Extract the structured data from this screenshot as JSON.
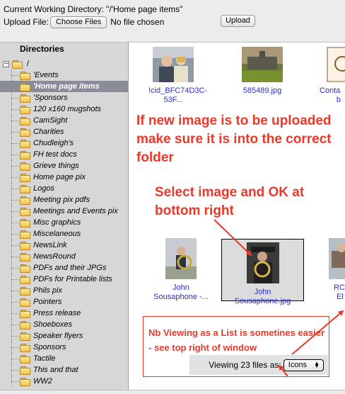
{
  "header": {
    "cwd_text": "Current Working Directory: \"/'Home page items\"",
    "upload_label": "Upload File:",
    "choose_files_label": "Choose Files",
    "no_file_label": "No file chosen",
    "upload_button_label": "Upload"
  },
  "sidebar": {
    "title": "Directories",
    "root_toggle": "−",
    "root_label": "/",
    "items": [
      {
        "label": "'Events"
      },
      {
        "label": "'Home page items",
        "selected": true
      },
      {
        "label": "'Sponsors"
      },
      {
        "label": "120 x160 mugshots"
      },
      {
        "label": "CamSight"
      },
      {
        "label": "Charities"
      },
      {
        "label": "Chudleigh's"
      },
      {
        "label": "FH test docs"
      },
      {
        "label": "Grieve things"
      },
      {
        "label": "Home page pix"
      },
      {
        "label": "Logos"
      },
      {
        "label": "Meeting pix pdfs"
      },
      {
        "label": "Meetings and Events pix"
      },
      {
        "label": "Misc graphics"
      },
      {
        "label": "Miscelaneous"
      },
      {
        "label": "NewsLink"
      },
      {
        "label": "NewsRound"
      },
      {
        "label": "PDFs and their JPGs"
      },
      {
        "label": "PDFs for Printable lists"
      },
      {
        "label": "Phils pix"
      },
      {
        "label": "Pointers"
      },
      {
        "label": "Press release"
      },
      {
        "label": "Shoeboxes"
      },
      {
        "label": "Speaker flyers"
      },
      {
        "label": "Sponsors"
      },
      {
        "label": "Tactile"
      },
      {
        "label": "This and that"
      },
      {
        "label": "WW2"
      }
    ]
  },
  "files": [
    {
      "name_line1": "!cid_BFC74D3C-",
      "name_line2": "53F..."
    },
    {
      "name_line1": "585489.jpg",
      "name_line2": ""
    },
    {
      "name_line1": "Conta",
      "name_line2": "b"
    },
    {
      "name_line1": "John",
      "name_line2": "Sousaphone -..."
    },
    {
      "name_line1": "John",
      "name_line2": "Sousaphone.jpg",
      "selected": true
    },
    {
      "name_line1": "RCO",
      "name_line2": "El"
    }
  ],
  "annotations": {
    "note1": "If new image is to be uploaded make sure it is into the correct folder",
    "note2": "Select image and OK at bottom right",
    "note3": "Nb Viewing as a List is sometines easier - see top right of window"
  },
  "viewbar": {
    "label": "Viewing 23 files as:",
    "selected_view": "Icons"
  },
  "colors": {
    "annotation_red": "#e8392a",
    "filename_blue": "#2a2fc7",
    "selected_tree_bg": "#8a8d97",
    "sidebar_bg": "#d7d7d7"
  }
}
